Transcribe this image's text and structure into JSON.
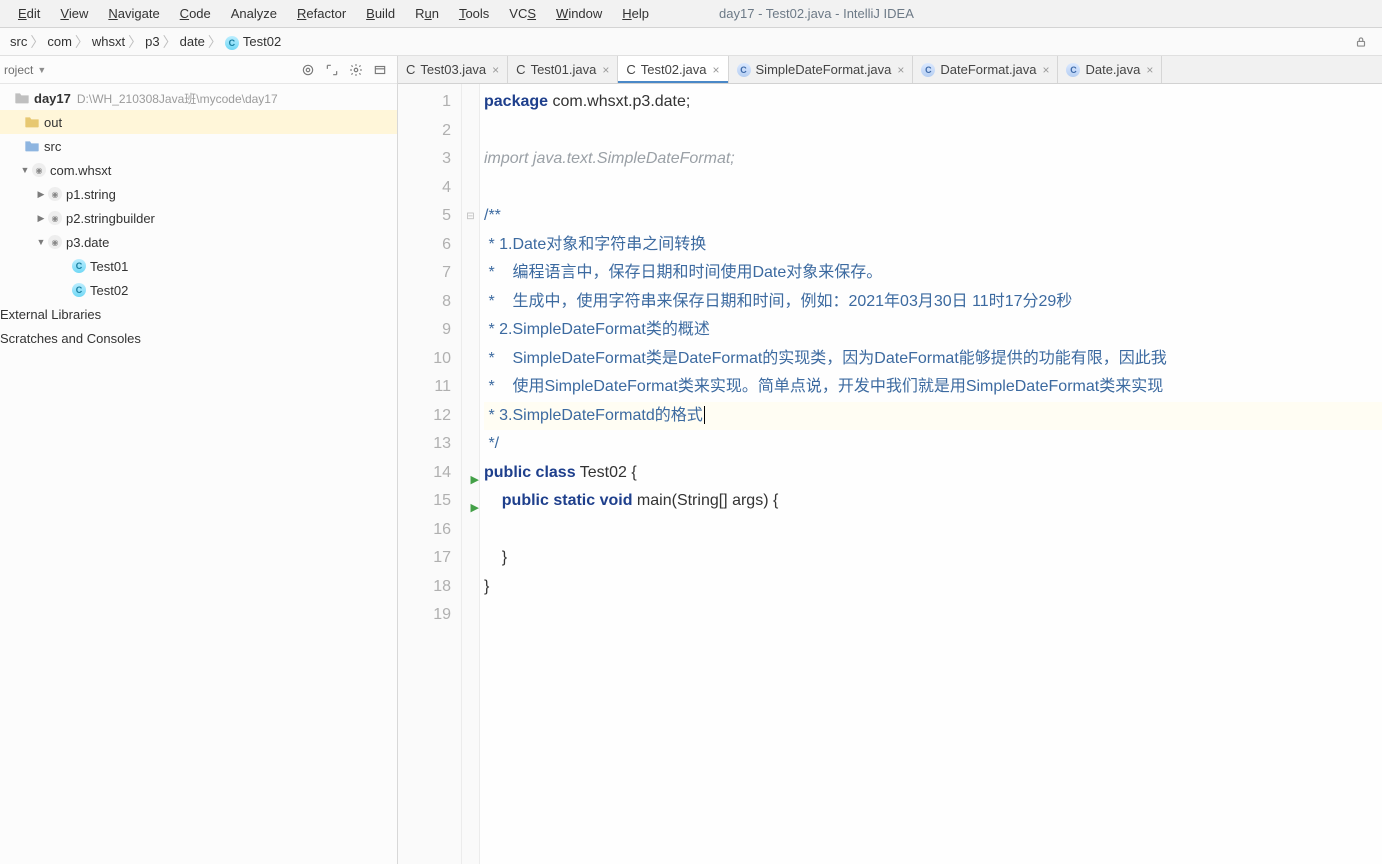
{
  "menu": {
    "items": [
      "Edit",
      "View",
      "Navigate",
      "Code",
      "Analyze",
      "Refactor",
      "Build",
      "Run",
      "Tools",
      "VCS",
      "Window",
      "Help"
    ],
    "underlines": [
      0,
      0,
      0,
      0,
      null,
      0,
      0,
      1,
      0,
      2,
      0,
      0
    ]
  },
  "window_title": "day17 - Test02.java - IntelliJ IDEA",
  "breadcrumbs": [
    "src",
    "com",
    "whsxt",
    "p3",
    "date",
    "Test02"
  ],
  "sidebar": {
    "title": "roject",
    "toolbar": {
      "target": "target-icon",
      "expand": "expand-icon",
      "gear": "gear-icon",
      "hide": "hide-icon"
    },
    "tree": [
      {
        "indent": 0,
        "arrow": "none",
        "kind": "module",
        "name": "day17",
        "path": "D:\\WH_210308Java班\\mycode\\day17",
        "bold": true
      },
      {
        "indent": 10,
        "arrow": "none",
        "kind": "folder-out",
        "name": "out",
        "highlight": true
      },
      {
        "indent": 10,
        "arrow": "none",
        "kind": "folder-src",
        "name": "src"
      },
      {
        "indent": 18,
        "arrow": "down",
        "kind": "pkg",
        "name": "com.whsxt"
      },
      {
        "indent": 34,
        "arrow": "right",
        "kind": "pkg",
        "name": "p1.string"
      },
      {
        "indent": 34,
        "arrow": "right",
        "kind": "pkg",
        "name": "p2.stringbuilder"
      },
      {
        "indent": 34,
        "arrow": "down",
        "kind": "pkg",
        "name": "p3.date"
      },
      {
        "indent": 58,
        "arrow": "none",
        "kind": "java",
        "name": "Test01"
      },
      {
        "indent": 58,
        "arrow": "none",
        "kind": "java",
        "name": "Test02"
      }
    ],
    "extras": [
      "External Libraries",
      "Scratches and Consoles"
    ]
  },
  "tabs": [
    {
      "icon": "j",
      "label": "Test03.java",
      "close": true
    },
    {
      "icon": "j",
      "label": "Test01.java",
      "close": true
    },
    {
      "icon": "j",
      "label": "Test02.java",
      "close": true,
      "active": true
    },
    {
      "icon": "lib",
      "label": "SimpleDateFormat.java",
      "close": true
    },
    {
      "icon": "lib",
      "label": "DateFormat.java",
      "close": true
    },
    {
      "icon": "lib",
      "label": "Date.java",
      "close": true
    }
  ],
  "code": {
    "lines": [
      {
        "n": 1,
        "html": "<span class='kw'>package</span> <span class='pkg'>com.whsxt.p3.date;</span>"
      },
      {
        "n": 2,
        "html": ""
      },
      {
        "n": 3,
        "html": "<span class='cmt'>import java.text.SimpleDateFormat;</span>"
      },
      {
        "n": 4,
        "html": ""
      },
      {
        "n": 5,
        "fold": "⊟",
        "html": "<span class='docblue'>/**</span>"
      },
      {
        "n": 6,
        "html": "<span class='docblue'> * 1.Date对象和字符串之间转换</span>"
      },
      {
        "n": 7,
        "html": "<span class='docblue'> *    编程语言中，保存日期和时间使用Date对象来保存。</span>"
      },
      {
        "n": 8,
        "html": "<span class='docblue'> *    生成中，使用字符串来保存日期和时间，例如：2021年03月30日 11时17分29秒</span>"
      },
      {
        "n": 9,
        "html": "<span class='docblue'> * 2.SimpleDateFormat类的概述</span>"
      },
      {
        "n": 10,
        "html": "<span class='docblue'> *    SimpleDateFormat类是DateFormat的实现类，因为DateFormat能够提供的功能有限，因此我</span>"
      },
      {
        "n": 11,
        "html": "<span class='docblue'> *    使用SimpleDateFormat类来实现。简单点说，开发中我们就是用SimpleDateFormat类来实现</span>"
      },
      {
        "n": 12,
        "hl": true,
        "html": "<span class='docblue'> * 3.SimpleDateFormatd的格式</span><span class='caret'></span>"
      },
      {
        "n": 13,
        "fold": "",
        "html": "<span class='docblue'> */</span>"
      },
      {
        "n": 14,
        "run": true,
        "html": "<span class='kw'>public class</span> <span class='typ'>Test02</span> {"
      },
      {
        "n": 15,
        "run": true,
        "html": "    <span class='kw'>public static void</span> <span class='typ'>main</span>(String[] args) {"
      },
      {
        "n": 16,
        "html": ""
      },
      {
        "n": 17,
        "html": "    }"
      },
      {
        "n": 18,
        "html": "}"
      },
      {
        "n": 19,
        "html": ""
      }
    ]
  }
}
